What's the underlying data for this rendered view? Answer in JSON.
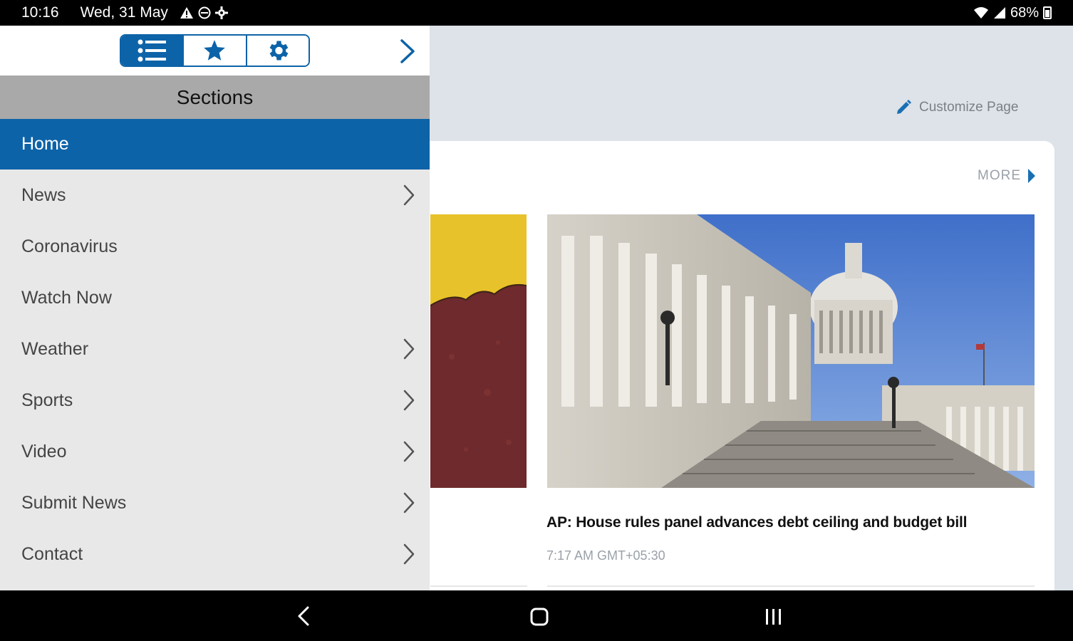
{
  "status": {
    "time": "10:16",
    "date": "Wed, 31 May",
    "battery": "68%"
  },
  "drawer": {
    "tabs": [
      {
        "name": "sections-tab",
        "icon": "list-icon",
        "active": true
      },
      {
        "name": "favorites-tab",
        "icon": "star-icon",
        "active": false
      },
      {
        "name": "settings-tab",
        "icon": "gear-icon",
        "active": false
      }
    ],
    "header": "Sections",
    "items": [
      {
        "label": "Home",
        "active": true,
        "chevron": false
      },
      {
        "label": "News",
        "active": false,
        "chevron": true
      },
      {
        "label": "Coronavirus",
        "active": false,
        "chevron": false
      },
      {
        "label": "Watch Now",
        "active": false,
        "chevron": false
      },
      {
        "label": "Weather",
        "active": false,
        "chevron": true
      },
      {
        "label": "Sports",
        "active": false,
        "chevron": true
      },
      {
        "label": "Video",
        "active": false,
        "chevron": true
      },
      {
        "label": "Submit News",
        "active": false,
        "chevron": true
      },
      {
        "label": "Contact",
        "active": false,
        "chevron": true
      }
    ]
  },
  "main": {
    "customize_label": "Customize Page",
    "more_label": "MORE",
    "headline": "AP: House rules panel advances debt ceiling and budget bill",
    "timestamp": "7:17 AM GMT+05:30"
  },
  "colors": {
    "accent": "#0d63a8",
    "drawer_bg": "#e8e8e8",
    "header_bg": "#a9a9a9",
    "page_bg": "#dde3e8"
  }
}
